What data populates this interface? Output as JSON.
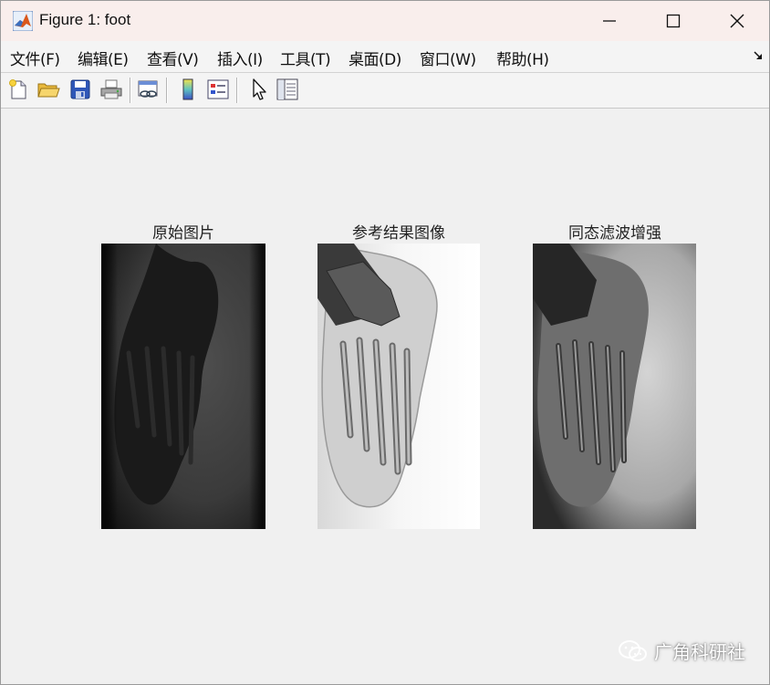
{
  "window": {
    "title": "Figure 1: foot",
    "app_icon": "matlab-icon",
    "controls": [
      "minimize-icon",
      "maximize-icon",
      "close-icon"
    ]
  },
  "menu": {
    "items": [
      "文件(F)",
      "编辑(E)",
      "查看(V)",
      "插入(I)",
      "工具(T)",
      "桌面(D)",
      "窗口(W)",
      "帮助(H)"
    ],
    "dock_icon": "dock-arrow-icon"
  },
  "toolbar": {
    "buttons": [
      "new-figure-icon",
      "open-file-icon",
      "save-icon",
      "print-icon",
      "link-plot-icon",
      "colorbar-icon",
      "legend-icon",
      "edit-plot-icon",
      "property-inspector-icon"
    ]
  },
  "figure": {
    "subplots": [
      {
        "title": "原始图片",
        "image": "original-foot-xray"
      },
      {
        "title": "参考结果图像",
        "image": "reference-result-foot-xray"
      },
      {
        "title": "同态滤波增强",
        "image": "homomorphic-filter-enhanced-foot-xray"
      }
    ]
  },
  "watermark": {
    "text": "广角科研社",
    "icon": "wechat-icon"
  }
}
